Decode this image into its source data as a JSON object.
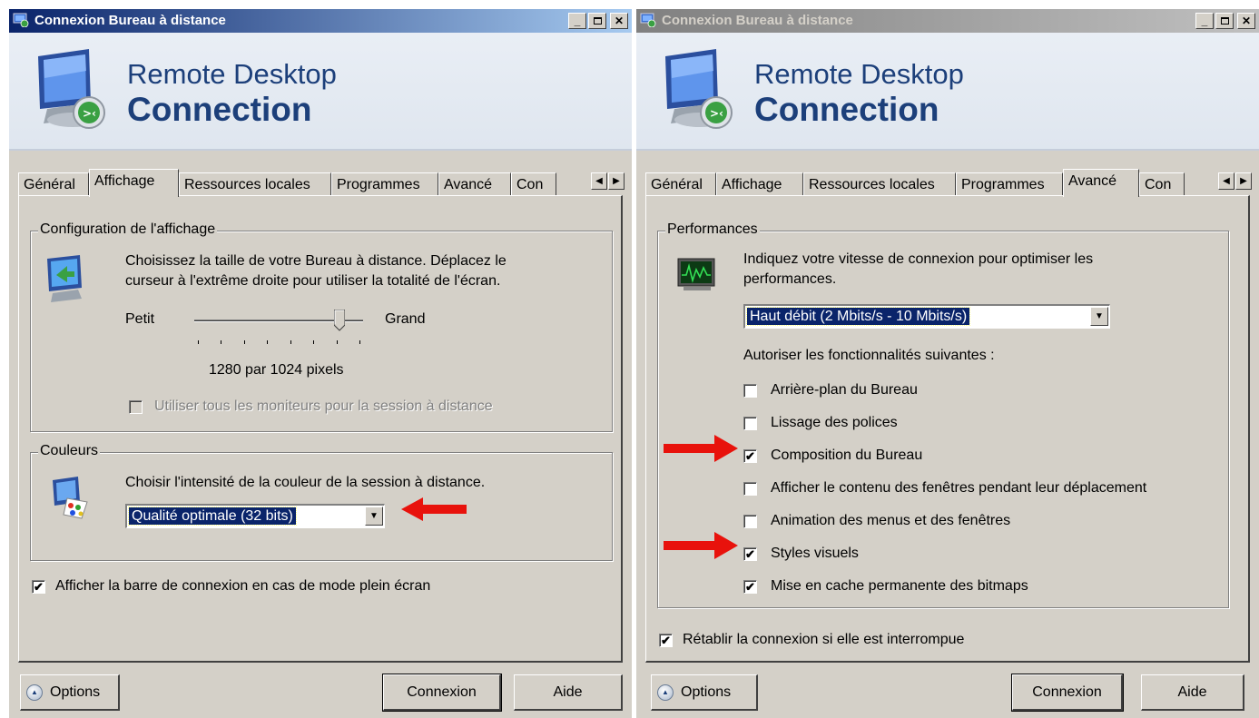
{
  "colors": {
    "arrow": "#e8120c",
    "title_active": "#0a246a",
    "banner_text": "#1c3f7a"
  },
  "left": {
    "window_title": "Connexion Bureau à distance",
    "banner": {
      "line1": "Remote Desktop",
      "line2": "Connection"
    },
    "tabs": [
      "Général",
      "Affichage",
      "Ressources locales",
      "Programmes",
      "Avancé",
      "Con"
    ],
    "active_tab": "Affichage",
    "display_group": {
      "legend": "Configuration de l'affichage",
      "description_line1": "Choisissez la taille de votre Bureau à distance. Déplacez le",
      "description_line2": "curseur à l'extrême droite pour utiliser la totalité de l'écran.",
      "slider_min_label": "Petit",
      "slider_max_label": "Grand",
      "slider_level_fraction": 0.86,
      "resolution": "1280 par 1024 pixels",
      "multi_monitor_label": "Utiliser tous les moniteurs pour la session à distance",
      "multi_monitor_checked": false
    },
    "colors_group": {
      "legend": "Couleurs",
      "description": "Choisir l'intensité de la couleur de la session à distance.",
      "selected": "Qualité optimale (32 bits)"
    },
    "fullscreen_bar_label": "Afficher la barre de connexion en cas de mode plein écran",
    "fullscreen_bar_checked": true,
    "buttons": {
      "options": "Options",
      "connect": "Connexion",
      "help": "Aide"
    }
  },
  "right": {
    "window_title": "Connexion Bureau à distance",
    "banner": {
      "line1": "Remote Desktop",
      "line2": "Connection"
    },
    "tabs": [
      "Général",
      "Affichage",
      "Ressources locales",
      "Programmes",
      "Avancé",
      "Con"
    ],
    "active_tab": "Avancé",
    "performance_group": {
      "legend": "Performances",
      "description_line1": "Indiquez votre vitesse de connexion pour optimiser les",
      "description_line2": "performances.",
      "speed_selected": "Haut débit (2 Mbits/s - 10 Mbits/s)",
      "features_label": "Autoriser les fonctionnalités suivantes :",
      "options": [
        {
          "label": "Arrière-plan du Bureau",
          "checked": false
        },
        {
          "label": "Lissage des polices",
          "checked": false
        },
        {
          "label": "Composition du Bureau",
          "checked": true
        },
        {
          "label": "Afficher le contenu des fenêtres pendant leur déplacement",
          "checked": false
        },
        {
          "label": "Animation des menus et des fenêtres",
          "checked": false
        },
        {
          "label": "Styles visuels",
          "checked": true
        },
        {
          "label": "Mise en cache permanente des bitmaps",
          "checked": true
        }
      ]
    },
    "reconnect_label": "Rétablir la connexion si elle est interrompue",
    "reconnect_checked": true,
    "buttons": {
      "options": "Options",
      "connect": "Connexion",
      "help": "Aide"
    }
  }
}
